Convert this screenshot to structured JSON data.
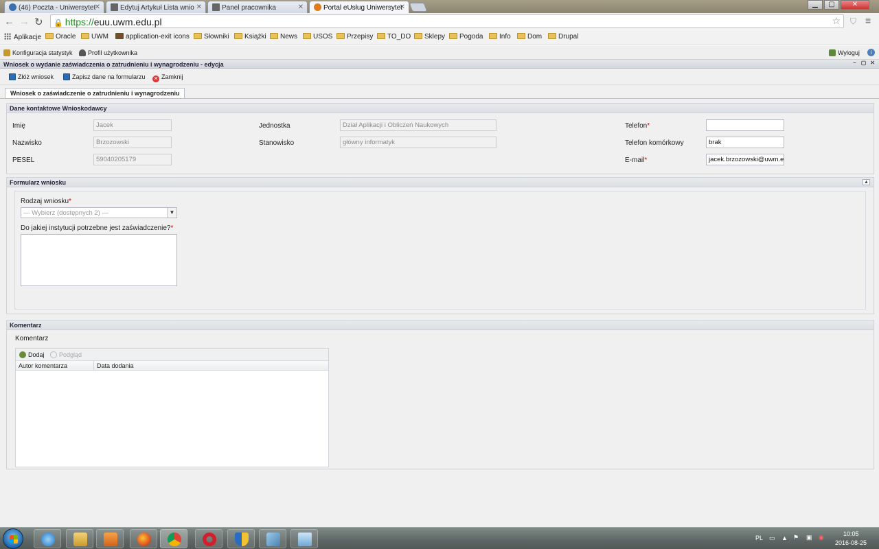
{
  "browser": {
    "tabs": [
      {
        "label": "(46) Poczta - Uniwersytet",
        "active": false
      },
      {
        "label": "Edytuj Artykuł Lista wnio",
        "active": false
      },
      {
        "label": "Panel pracownika",
        "active": false
      },
      {
        "label": "Portal eUsług Uniwersytet",
        "active": true
      }
    ],
    "url_scheme": "https://",
    "url_host": "euu.uwm.edu.pl",
    "bookmarks": [
      "Aplikacje",
      "Oracle",
      "UWM",
      "application-exit icons",
      "Słowniki",
      "Książki",
      "News",
      "USOS",
      "Przepisy",
      "TO_DO",
      "Sklepy",
      "Pogoda",
      "Info",
      "Dom",
      "Drupal"
    ]
  },
  "app_menu": {
    "config": "Konfiguracja statystyk",
    "profile": "Profil użytkownika",
    "logout": "Wyloguj"
  },
  "window": {
    "title": "Wniosek o wydanie zaświadczenia o zatrudnieniu i wynagrodzeniu - edycja",
    "toolbar": {
      "submit": "Złóż wniosek",
      "save": "Zapisz dane na formularzu",
      "close": "Zamknij"
    },
    "tab": "Wniosek o zaświadczenie o zatrudnieniu i wynagrodzeniu"
  },
  "contact": {
    "header": "Dane kontaktowe Wnioskodawcy",
    "first_name_label": "Imię",
    "first_name": "Jacek",
    "last_name_label": "Nazwisko",
    "last_name": "Brzozowski",
    "pesel_label": "PESEL",
    "pesel": "59040205179",
    "unit_label": "Jednostka",
    "unit": "Dział Aplikacji i Obliczeń Naukowych",
    "position_label": "Stanowisko",
    "position": "główny informatyk",
    "phone_label": "Telefon",
    "phone": "",
    "mobile_label": "Telefon komórkowy",
    "mobile": "brak",
    "email_label": "E-mail",
    "email": "jacek.brzozowski@uwm.edu.pl",
    "required_mark": "*"
  },
  "form": {
    "header": "Formularz wniosku",
    "type_label": "Rodzaj wniosku",
    "type_placeholder": "— Wybierz (dostępnych 2) —",
    "institution_label": "Do jakiej instytucji potrzebne jest zaświadczenie?",
    "institution_value": ""
  },
  "comments": {
    "header": "Komentarz",
    "label": "Komentarz",
    "add": "Dodaj",
    "preview": "Podgląd",
    "col_author": "Autor komentarza",
    "col_date": "Data dodania"
  },
  "taskbar": {
    "lang": "PL",
    "time": "10:05",
    "date": "2016-08-25"
  },
  "colors": {
    "accent": "#2e6bb0",
    "required": "#cc0000",
    "secure": "#1c8c1c"
  }
}
